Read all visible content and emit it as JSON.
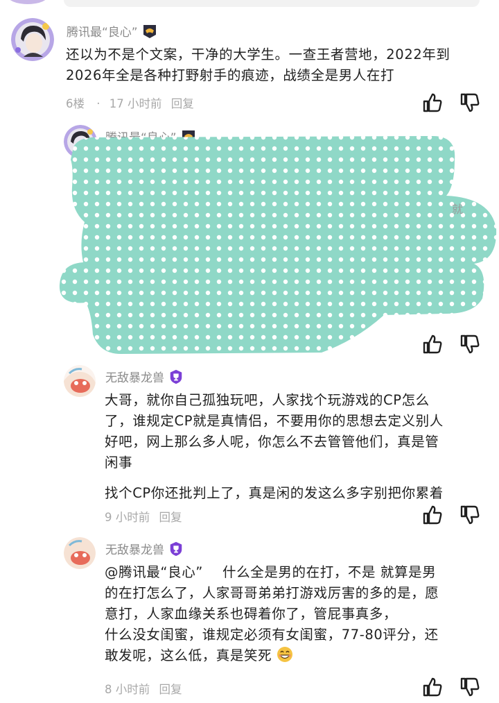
{
  "comments": [
    {
      "author": "腾讯最“良心”",
      "lines": [
        "还以为不是个文案，干净的大学生。一查王者营地，2022年到",
        "2026年全是各种打野射手的痕迹，战绩全是男人在打"
      ],
      "floor": "6楼",
      "dot": "·",
      "time": "17 小时前",
      "reply": "回复"
    },
    {
      "author": "腾讯最“良心”"
    },
    {
      "author": "无敌暴龙兽",
      "lines": [
        "大哥，就你自己孤独玩吧，人家找个玩游戏的CP怎么",
        "了，谁规定CP就是真情侣，不要用你的思想去定义别人",
        "好吧，网上那么多人呢，你怎么不去管管他们，真是管",
        "闲事"
      ],
      "line2": "找个CP你还批判上了，真是闲的发这么多字别把你累着",
      "time": "9 小时前",
      "reply": "回复"
    },
    {
      "author": "无敌暴龙兽",
      "mention": "@腾讯最“良心”",
      "lines": [
        "什么全是男的在打，不是 就算是男",
        "的在打怎么了，人家哥哥弟弟打游戏厉害的多的是，愿",
        "意打，人家血缘关系也碍着你了，管屁事真多，",
        "什么没女闺蜜，谁规定必须有女闺蜜，77-80评分，还",
        "敢发呢，这么低，真是笑死"
      ],
      "time": "8 小时前",
      "reply": "回复"
    }
  ],
  "colors": {
    "censor": "#8fd8c7",
    "badge_purple": "#7b3fd6",
    "meta_gray": "#a8a8a8"
  },
  "icons": {
    "like": "thumbs-up-icon",
    "dislike": "thumbs-down-icon"
  }
}
